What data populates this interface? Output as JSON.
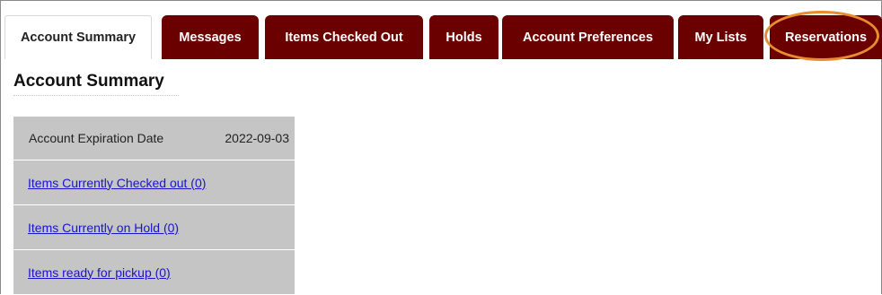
{
  "tabs": [
    {
      "label": "Account Summary",
      "active": true
    },
    {
      "label": "Messages",
      "active": false
    },
    {
      "label": "Items Checked Out",
      "active": false
    },
    {
      "label": "Holds",
      "active": false
    },
    {
      "label": "Account Preferences",
      "active": false
    },
    {
      "label": "My Lists",
      "active": false
    },
    {
      "label": "Reservations",
      "active": false,
      "highlighted": true
    }
  ],
  "page_title": "Account Summary",
  "summary": {
    "expiration_label": "Account Expiration Date",
    "expiration_value": "2022-09-03",
    "links": [
      {
        "label": "Items Currently Checked out (0)"
      },
      {
        "label": "Items Currently on Hold (0)"
      },
      {
        "label": "Items ready for pickup (0)"
      }
    ]
  },
  "colors": {
    "tab_dark": "#6b0000",
    "highlight_ring": "#e88b31",
    "panel_bg": "#c5c5c5",
    "link": "#1a14c9"
  }
}
